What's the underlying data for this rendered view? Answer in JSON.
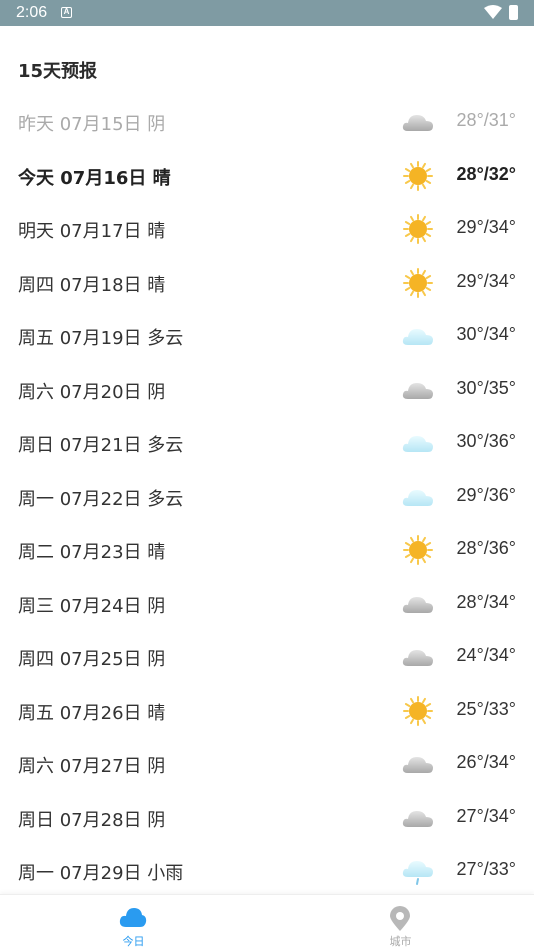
{
  "status_bar": {
    "time": "2:06",
    "notification_icon": "a-letter-icon"
  },
  "title": "15天预报",
  "forecast": [
    {
      "date": "昨天 07月15日 阴",
      "weather": "overcast",
      "temp": "28°/31°"
    },
    {
      "date": "今天 07月16日 晴",
      "weather": "sunny",
      "temp": "28°/32°"
    },
    {
      "date": "明天 07月17日 晴",
      "weather": "sunny",
      "temp": "29°/34°"
    },
    {
      "date": "周四 07月18日 晴",
      "weather": "sunny",
      "temp": "29°/34°"
    },
    {
      "date": "周五 07月19日 多云",
      "weather": "cloudy",
      "temp": "30°/34°"
    },
    {
      "date": "周六 07月20日 阴",
      "weather": "overcast",
      "temp": "30°/35°"
    },
    {
      "date": "周日 07月21日 多云",
      "weather": "cloudy",
      "temp": "30°/36°"
    },
    {
      "date": "周一 07月22日 多云",
      "weather": "cloudy",
      "temp": "29°/36°"
    },
    {
      "date": "周二 07月23日 晴",
      "weather": "sunny",
      "temp": "28°/36°"
    },
    {
      "date": "周三 07月24日 阴",
      "weather": "overcast",
      "temp": "28°/34°"
    },
    {
      "date": "周四 07月25日 阴",
      "weather": "overcast",
      "temp": "24°/34°"
    },
    {
      "date": "周五 07月26日 晴",
      "weather": "sunny",
      "temp": "25°/33°"
    },
    {
      "date": "周六 07月27日 阴",
      "weather": "overcast",
      "temp": "26°/34°"
    },
    {
      "date": "周日 07月28日 阴",
      "weather": "overcast",
      "temp": "27°/34°"
    },
    {
      "date": "周一 07月29日 小雨",
      "weather": "light-rain",
      "temp": "27°/33°"
    }
  ],
  "tabs": [
    {
      "label": "今日",
      "icon": "cloud-icon",
      "active": true
    },
    {
      "label": "城市",
      "icon": "location-pin-icon",
      "active": false
    }
  ],
  "colors": {
    "status_bar": "#7f9ba3",
    "accent": "#2a9bf0",
    "sun": "#f5b425"
  }
}
